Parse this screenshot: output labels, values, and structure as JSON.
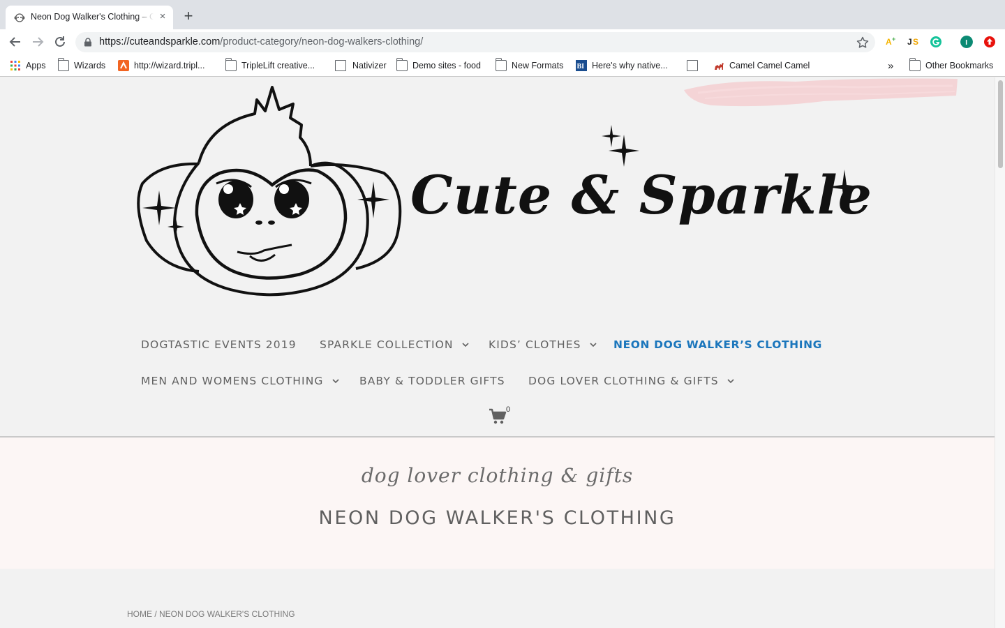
{
  "browser": {
    "tab_title": "Neon Dog Walker's Clothing – Cute & Sparkle",
    "tab_close_label": "×",
    "new_tab_label": "+",
    "url_host": "https://cuteandsparkle.com",
    "url_path": "/product-category/neon-dog-walkers-clothing/",
    "extensions": [
      {
        "name": "a-plus-icon",
        "color": "#f5b400"
      },
      {
        "name": "js-icon",
        "color": "#222222"
      },
      {
        "name": "grammarly-icon",
        "color": "#15c39a"
      },
      {
        "name": "profile-icon",
        "color": "#0b8a73",
        "label": "I"
      },
      {
        "name": "upload-icon",
        "color": "#e8120c"
      }
    ]
  },
  "bookmarks": {
    "items": [
      {
        "label": "Apps",
        "icon": "apps-grid-icon"
      },
      {
        "label": "Wizards",
        "icon": "folder-icon"
      },
      {
        "label": "http://wizard.tripl...",
        "icon": "triplelift-icon"
      },
      {
        "label": "TripleLift creative...",
        "icon": "folder-icon"
      },
      {
        "label": "Nativizer",
        "icon": "page-icon"
      },
      {
        "label": "Demo sites - food",
        "icon": "folder-icon"
      },
      {
        "label": "New Formats",
        "icon": "folder-icon"
      },
      {
        "label": "Here's why native...",
        "icon": "business-insider-icon"
      },
      {
        "label": "",
        "icon": "page-icon"
      },
      {
        "label": "Camel Camel Camel",
        "icon": "camel-icon"
      }
    ],
    "overflow_label": "»",
    "other_label": "Other Bookmarks"
  },
  "site": {
    "logo_text": "Cute & Sparkle",
    "nav": [
      {
        "label": "DOGTASTIC EVENTS 2019",
        "has_dropdown": false,
        "active": false
      },
      {
        "label": "SPARKLE COLLECTION",
        "has_dropdown": true,
        "active": false
      },
      {
        "label": "KIDS’ CLOTHES",
        "has_dropdown": true,
        "active": false
      },
      {
        "label": "NEON DOG WALKER’S CLOTHING",
        "has_dropdown": false,
        "active": true
      },
      {
        "label": "MEN AND WOMENS CLOTHING",
        "has_dropdown": true,
        "active": false
      },
      {
        "label": "BABY & TODDLER GIFTS",
        "has_dropdown": false,
        "active": false
      },
      {
        "label": "DOG LOVER CLOTHING & GIFTS",
        "has_dropdown": true,
        "active": false
      }
    ],
    "cart_count": "0",
    "accent_color": "#1b76bc",
    "hero_tagline": "dog lover clothing & gifts",
    "hero_title": "NEON DOG WALKER'S CLOTHING",
    "breadcrumb_home": "HOME",
    "breadcrumb_sep": " / ",
    "breadcrumb_current": "NEON DOG WALKER'S CLOTHING"
  }
}
